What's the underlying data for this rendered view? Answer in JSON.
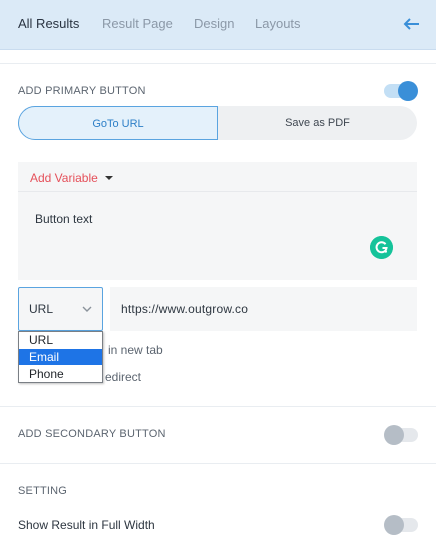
{
  "tabs": [
    {
      "label": "All Results"
    },
    {
      "label": "Result Page"
    },
    {
      "label": "Design"
    },
    {
      "label": "Layouts"
    }
  ],
  "primary": {
    "section_label": "ADD PRIMARY BUTTON",
    "toggle_on": true,
    "options": [
      "GoTo URL",
      "Save as PDF"
    ],
    "selected_option": "GoTo URL"
  },
  "editor": {
    "add_variable_label": "Add Variable",
    "button_text": "Button text"
  },
  "link": {
    "type_selected": "URL",
    "type_options": [
      "URL",
      "Email",
      "Phone"
    ],
    "highlighted_option": "Email",
    "url_value": "https://www.outgrow.co",
    "new_tab_label_partial": "in new tab",
    "redirect_label_partial": "edirect"
  },
  "secondary": {
    "section_label": "ADD SECONDARY BUTTON",
    "toggle_on": false
  },
  "setting": {
    "section_label": "SETTING",
    "full_width_label": "Show Result in Full Width",
    "full_width_on": false
  },
  "colors": {
    "accent_blue": "#3a8fd8",
    "variable_red": "#e5505a",
    "grammarly_green": "#15c39a",
    "header_bg": "#dbeaf7",
    "dropdown_highlight": "#1e74e6"
  },
  "icons": {
    "back": "arrow-left-icon",
    "chevron": "chevron-down-icon",
    "caret": "caret-down-icon",
    "grammarly": "grammarly-icon"
  }
}
